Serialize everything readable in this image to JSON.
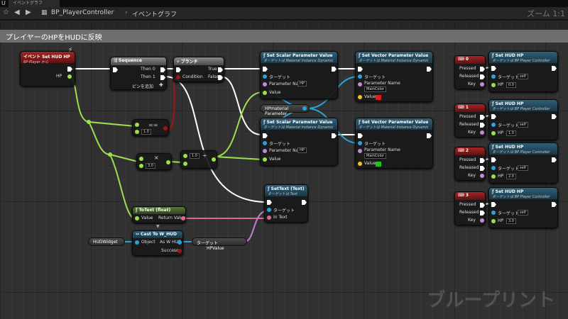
{
  "window": {
    "tab_title": "イベントグラフ",
    "logo": "U"
  },
  "toolbar": {
    "star_icon": "star-icon",
    "back_icon": "back-icon",
    "forward_icon": "forward-icon",
    "breadcrumb": [
      "BP_PlayerController",
      "イベントグラフ"
    ],
    "zoom": "ズーム 1:1"
  },
  "comment": {
    "title": "プレイヤーのHPをHUDに反映"
  },
  "watermark": "ブループリント",
  "nodes": {
    "event": {
      "title": "イベント Set HUD HP",
      "subtitle": "BP Player から",
      "pin_hp": "HP"
    },
    "sequence": {
      "title": "Sequence",
      "then0": "Then 0",
      "then1": "Then 1",
      "add_pin": "ピンを追加"
    },
    "branch": {
      "title": "ブランチ",
      "condition": "Condition",
      "true": "True",
      "false": "False"
    },
    "compare": {
      "value": "1.0"
    },
    "multiply": {
      "value": "3.0"
    },
    "divide": {
      "value": "1.0"
    },
    "scalar1": {
      "title": "Set Scalar Parameter Value",
      "subtitle": "ターゲットは Material Instance Dynamic",
      "target": "ターゲット",
      "param_name": "Parameter Name",
      "param_value": "HP",
      "value": "Value"
    },
    "vector1": {
      "title": "Set Vector Parameter Value",
      "subtitle": "ターゲットは Material Instance Dynamic",
      "target": "ターゲット",
      "param_name": "Parameter Name",
      "param_value": "MainColor",
      "value": "Value",
      "color": "#d81e1e"
    },
    "hp_material": {
      "label": "HPmaterial Parameter"
    },
    "scalar2": {
      "title": "Set Scalar Parameter Value",
      "subtitle": "ターゲットは Material Instance Dynamic",
      "target": "ターゲット",
      "param_name": "Parameter Name",
      "param_value": "HP",
      "value": "Value"
    },
    "vector2": {
      "title": "Set Vector Parameter Value",
      "subtitle": "ターゲットは Material Instance Dynamic",
      "target": "ターゲット",
      "param_name": "Parameter Name",
      "param_value": "MainColor",
      "value": "Value",
      "color": "#22c022"
    },
    "settext": {
      "title": "SetText (Text)",
      "subtitle": "ターゲットは Text",
      "target": "ターゲット",
      "in_text": "In Text"
    },
    "totext": {
      "title": "ToText (float)",
      "value": "Value",
      "return": "Return Value"
    },
    "cast": {
      "title": "Cast To W_HUD",
      "object": "Object",
      "as": "As W HUD",
      "success": "Success"
    },
    "hudwidget": {
      "label": "HUDWidget"
    },
    "hpvalue": {
      "target": "ターゲット",
      "label": "HPValue"
    }
  },
  "key_nodes": [
    {
      "key": "0",
      "title": "Set HUD HP",
      "subtitle": "ターゲットは BP Player Controller",
      "pressed": "Pressed",
      "released": "Released",
      "key_label": "Key",
      "target": "ターゲット",
      "self": "self",
      "hp": "HP",
      "hp_value": "0.0"
    },
    {
      "key": "1",
      "title": "Set HUD HP",
      "subtitle": "ターゲットは BP Player Controller",
      "pressed": "Pressed",
      "released": "Released",
      "key_label": "Key",
      "target": "ターゲット",
      "self": "self",
      "hp": "HP",
      "hp_value": "1.0"
    },
    {
      "key": "2",
      "title": "Set HUD HP",
      "subtitle": "ターゲットは BP Player Controller",
      "pressed": "Pressed",
      "released": "Released",
      "key_label": "Key",
      "target": "ターゲット",
      "self": "self",
      "hp": "HP",
      "hp_value": "2.0"
    },
    {
      "key": "3",
      "title": "Set HUD HP",
      "subtitle": "ターゲットは BP Player Controller",
      "pressed": "Pressed",
      "released": "Released",
      "key_label": "Key",
      "target": "ターゲット",
      "self": "self",
      "hp": "HP",
      "hp_value": "3.0"
    }
  ],
  "colors": {
    "exec": "#ffffff",
    "float": "#9be04e",
    "bool": "#a11515",
    "object": "#2aa3d8",
    "name": "#c08bd8",
    "text": "#e0678f",
    "struct": "#f0c020"
  }
}
